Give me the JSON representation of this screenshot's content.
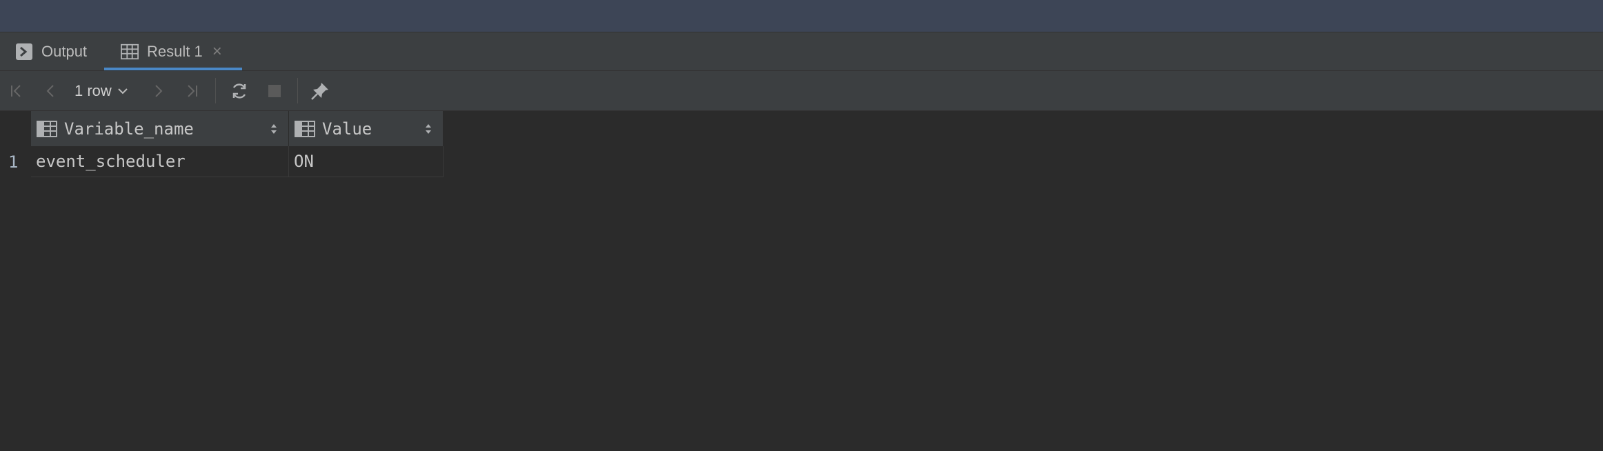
{
  "tabs": {
    "output_label": "Output",
    "result_label": "Result 1",
    "close_symbol": "×"
  },
  "toolbar": {
    "row_count": "1 row"
  },
  "table": {
    "columns": [
      "Variable_name",
      "Value"
    ],
    "rows": [
      {
        "num": "1",
        "cells": [
          "event_scheduler",
          "ON"
        ]
      }
    ]
  },
  "colors": {
    "background": "#2b2b2b",
    "topbar": "#3d4556",
    "panel": "#3c3f41",
    "active_tab_underline": "#4a88c7"
  },
  "icons": {
    "output_tab": "console-icon",
    "result_tab": "table-icon",
    "first": "first-page-icon",
    "prev": "prev-page-icon",
    "next": "next-page-icon",
    "last": "last-page-icon",
    "reload": "reload-icon",
    "stop": "stop-icon",
    "pin": "pin-icon",
    "column": "column-icon",
    "sort": "sort-icon"
  }
}
